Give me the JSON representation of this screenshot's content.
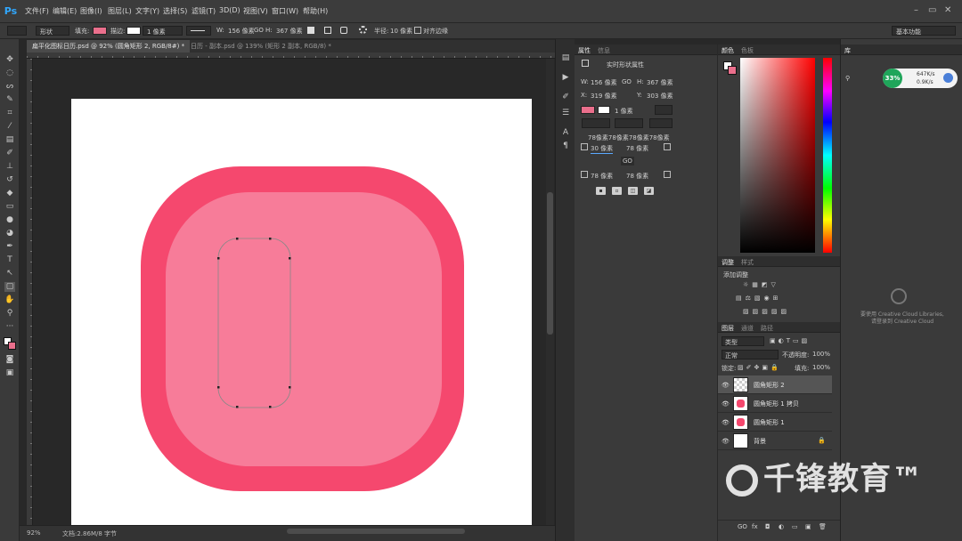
{
  "app": {
    "logo": "Ps"
  },
  "menu": [
    "文件(F)",
    "编辑(E)",
    "图像(I)",
    "图层(L)",
    "文字(Y)",
    "选择(S)",
    "滤镜(T)",
    "3D(D)",
    "视图(V)",
    "窗口(W)",
    "帮助(H)"
  ],
  "window_controls": [
    "–",
    "▭",
    "✕"
  ],
  "options_bar": {
    "mode": "形状",
    "fill_label": "填充:",
    "stroke_label": "描边:",
    "stroke_width": "1 像素",
    "w_label": "W:",
    "w_value": "156 像素",
    "link": "GO",
    "h_label": "H:",
    "h_value": "367 像素",
    "radius_label": "半径:",
    "radius_value": "10 像素",
    "align_edges": "对齐边缘",
    "workspace": "基本功能"
  },
  "tabs": [
    {
      "label": "扁平化图标日历.psd @ 92% (圆角矩形 2, RGB/8#) *",
      "active": true
    },
    {
      "label": "日历 - 副本.psd @ 139% (矩形 2 副本, RGB/8) *",
      "active": false
    }
  ],
  "status": {
    "zoom": "92%",
    "doc": "文档:2.86M/8 字节"
  },
  "properties": {
    "tabs": [
      "属性",
      "信息"
    ],
    "title": "实时形状属性",
    "w_label": "W:",
    "w_value": "156 像素",
    "h_label": "H:",
    "h_value": "367 像素",
    "x_label": "X:",
    "x_value": "319 像素",
    "y_label": "Y:",
    "y_value": "303 像素",
    "stroke_width": "1 像素",
    "corner_all": "78像素78像素78像素78像素",
    "corner_tl": "30 像素",
    "corner_tr": "78 像素",
    "corner_bl": "78 像素",
    "corner_br": "78 像素",
    "link_icon": "GO"
  },
  "color_panel": {
    "tabs": [
      "颜色",
      "色板"
    ],
    "accent": "#f04d74"
  },
  "adjustments": {
    "tabs": [
      "调整",
      "样式"
    ],
    "title": "添加调整"
  },
  "layers": {
    "tabs": [
      "图层",
      "通道",
      "路径"
    ],
    "filter": "类型",
    "blend": "正常",
    "opacity_label": "不透明度:",
    "opacity": "100%",
    "lock_label": "锁定:",
    "fill_label": "填充:",
    "fill": "100%",
    "items": [
      {
        "name": "圆角矩形 2",
        "selected": true,
        "thumb": "checker"
      },
      {
        "name": "圆角矩形 1 拷贝",
        "selected": false,
        "thumb": "pink"
      },
      {
        "name": "圆角矩形 1",
        "selected": false,
        "thumb": "pink"
      },
      {
        "name": "背景",
        "selected": false,
        "thumb": "white"
      }
    ],
    "bottom_icons": [
      "GO",
      "fx",
      "◘",
      "◐",
      "▭",
      "▣",
      "🗑"
    ]
  },
  "libraries": {
    "tab": "库",
    "cpu": "33%",
    "net_up": "647K/s",
    "net_down": "0.9K/s",
    "cc_msg1": "要使用 Creative Cloud Libraries,",
    "cc_msg2": "请登录到 Creative Cloud"
  },
  "watermark": "千锋教育™",
  "colors": {
    "outer_shape": "#f5486e",
    "inner_shape": "#f77c99",
    "path_line": "#888888",
    "canvas": "#ffffff"
  }
}
